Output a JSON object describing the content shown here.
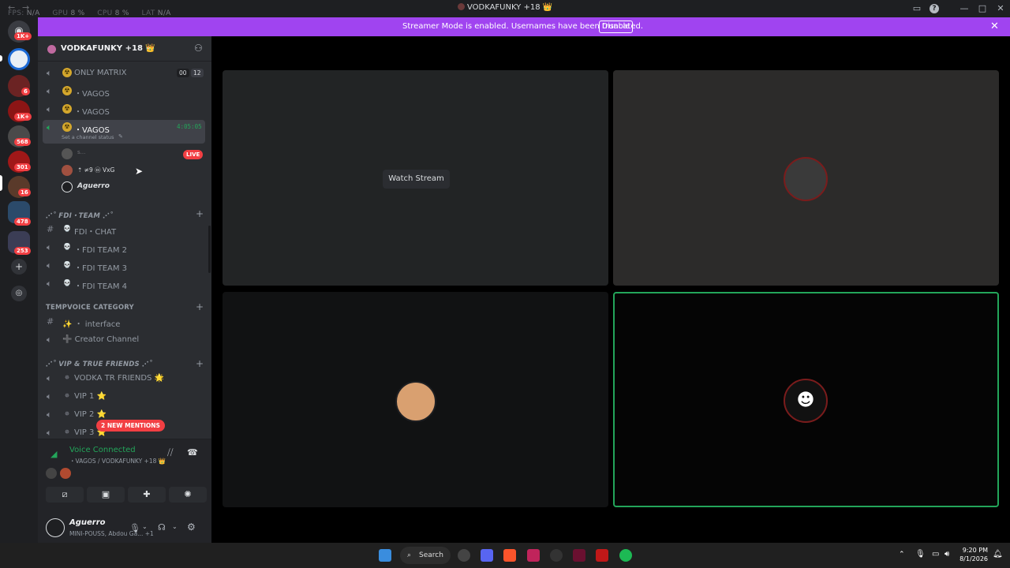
{
  "titlebar": {
    "stats": [
      {
        "label": "FPS:",
        "value": "N/A"
      },
      {
        "label": "GPU",
        "value": "8 %"
      },
      {
        "label": "CPU",
        "value": "8 %"
      },
      {
        "label": "LAT",
        "value": "N/A"
      }
    ],
    "title": "VODKAFUNKY +18 👑"
  },
  "banner": {
    "text": "Streamer Mode is enabled. Usernames have been truncated.",
    "button": "Disable"
  },
  "rail": {
    "servers": [
      {
        "badge": "1K+"
      },
      {
        "badge": ""
      },
      {
        "badge": "6"
      },
      {
        "badge": "1K+"
      },
      {
        "badge": "568"
      },
      {
        "badge": "301"
      },
      {
        "badge": "16"
      },
      {
        "badge": "478"
      },
      {
        "badge": "253"
      }
    ]
  },
  "sidebar": {
    "server_name": "VODKAFUNKY +18 👑",
    "channels_top": [
      {
        "label": "ONLY MATRIX",
        "counter_a": "00",
        "counter_b": "12"
      },
      {
        "label": "・VAGOS"
      },
      {
        "label": "・VAGOS"
      }
    ],
    "active_channel": {
      "label": "・VAGOS",
      "timer": "4:05:05",
      "status": "Set a channel status"
    },
    "members": [
      {
        "name": "s..."
      },
      {
        "name": "⇡ ≠9  ㉤ VxG"
      },
      {
        "name": "Aguerro"
      }
    ],
    "live_badge": "LIVE",
    "categories": [
      {
        "label": "⋰˚ FDI・TEAM ⋰˚"
      },
      {
        "label": "TEMPVOICE CATEGORY"
      },
      {
        "label": "⋰˚ VIP & TRUE FRIENDS ⋰˚"
      }
    ],
    "fdi_channels": [
      "FDI・CHAT",
      "・FDI TEAM 2",
      "・FDI TEAM 3",
      "・FDI TEAM 4"
    ],
    "temp_channels": [
      "✨ ・ interface",
      "➕ Creator Channel"
    ],
    "vip_channels": [
      "VODKA TR FRIENDS 🌟",
      "VIP 1 ⭐",
      "VIP 2 ⭐",
      "VIP 3 ⭐"
    ],
    "mentions_pill": "2 NEW MENTIONS"
  },
  "voice": {
    "status": "Voice Connected",
    "location": "・VAGOS / VODKAFUNKY +18 👑"
  },
  "user": {
    "name": "Aguerro",
    "status": "MINI-POUSS, Abdou Ga... +1"
  },
  "stage": {
    "watch_label": "Watch Stream"
  },
  "taskbar": {
    "search": "Search",
    "time": "9:20 PM",
    "date": "8/1/2026"
  }
}
